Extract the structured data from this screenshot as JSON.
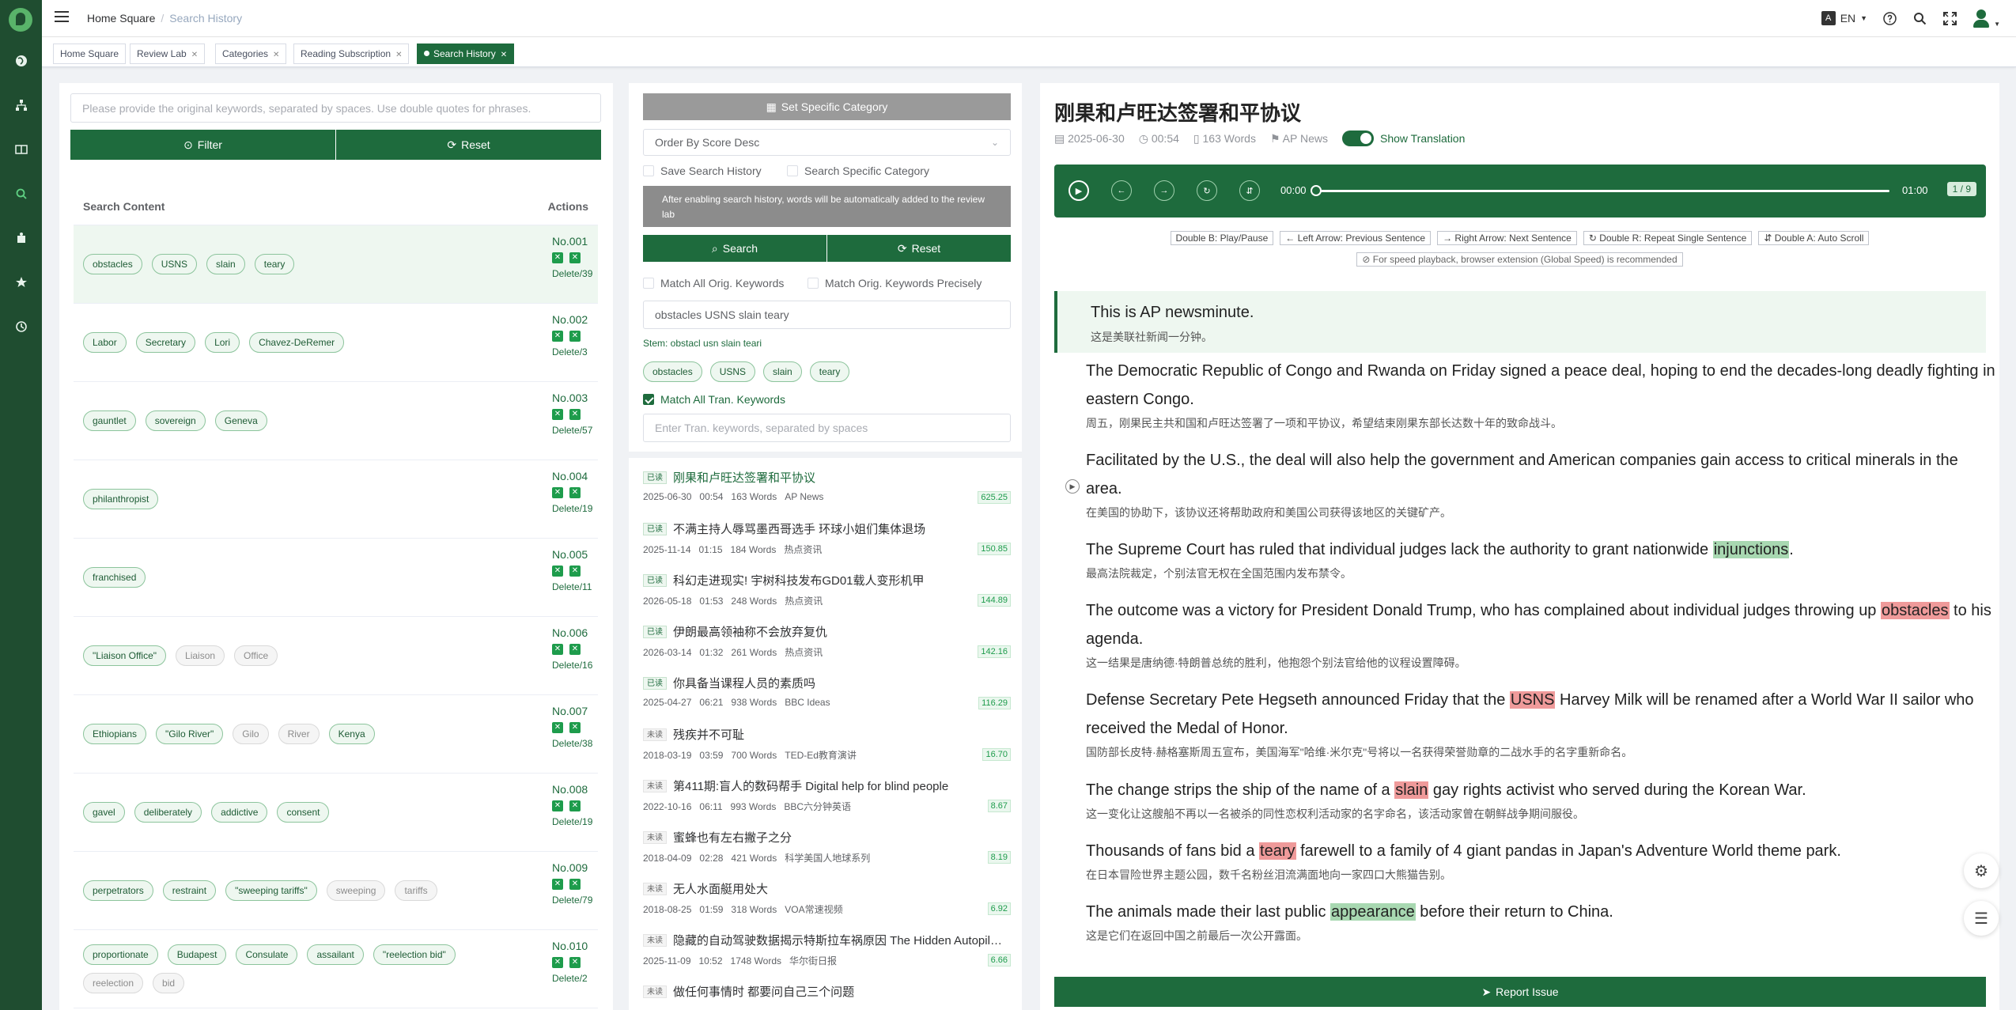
{
  "sidebar": {
    "items": [
      "world-icon",
      "sitemap-icon",
      "book-icon",
      "search-icon",
      "feed-icon",
      "star-icon",
      "history-icon"
    ]
  },
  "header": {
    "breadcrumb": {
      "home": "Home Square",
      "current": "Search History"
    },
    "lang": "EN",
    "lang_icon": "A"
  },
  "tabs": [
    {
      "label": "Home Square"
    },
    {
      "label": "Review Lab"
    },
    {
      "label": "Categories"
    },
    {
      "label": "Reading Subscription"
    },
    {
      "label": "Search History"
    }
  ],
  "history": {
    "placeholder": "Please provide the original keywords, separated by spaces. Use double quotes for phrases.",
    "filter_label": "Filter",
    "reset_label": "Reset",
    "col_content": "Search Content",
    "col_actions": "Actions",
    "rows": [
      {
        "no": "No.001",
        "del": "Delete/39",
        "kw": [
          "obstacles",
          "USNS",
          "slain",
          "teary"
        ],
        "grey": []
      },
      {
        "no": "No.002",
        "del": "Delete/3",
        "kw": [
          "Labor",
          "Secretary",
          "Lori",
          "Chavez-DeRemer"
        ],
        "grey": []
      },
      {
        "no": "No.003",
        "del": "Delete/57",
        "kw": [
          "gauntlet",
          "sovereign",
          "Geneva"
        ],
        "grey": []
      },
      {
        "no": "No.004",
        "del": "Delete/19",
        "kw": [
          "philanthropist"
        ],
        "grey": []
      },
      {
        "no": "No.005",
        "del": "Delete/11",
        "kw": [
          "franchised"
        ],
        "grey": []
      },
      {
        "no": "No.006",
        "del": "Delete/16",
        "kw": [
          "\"Liaison Office\""
        ],
        "grey": [
          "Liaison",
          "Office"
        ]
      },
      {
        "no": "No.007",
        "del": "Delete/38",
        "kw": [
          "Ethiopians",
          "\"Gilo River\""
        ],
        "grey": [
          "Gilo",
          "River"
        ],
        "kw2": [
          "Kenya"
        ]
      },
      {
        "no": "No.008",
        "del": "Delete/19",
        "kw": [
          "gavel",
          "deliberately",
          "addictive",
          "consent"
        ],
        "grey": []
      },
      {
        "no": "No.009",
        "del": "Delete/79",
        "kw": [
          "perpetrators",
          "restraint",
          "\"sweeping tariffs\""
        ],
        "grey": [
          "sweeping",
          "tariffs"
        ]
      },
      {
        "no": "No.010",
        "del": "Delete/2",
        "kw": [
          "proportionate",
          "Budapest",
          "Consulate",
          "assailant",
          "\"reelection bid\""
        ],
        "grey": [
          "reelection",
          "bid"
        ]
      }
    ]
  },
  "search": {
    "set_category": "Set Specific Category",
    "order": "Order By Score Desc",
    "save_history": "Save Search History",
    "search_category": "Search Specific Category",
    "note": "After enabling search history, words will be automatically added to the review lab",
    "search_label": "Search",
    "reset_label": "Reset",
    "match_all": "Match All Orig. Keywords",
    "match_precise": "Match Orig. Keywords Precisely",
    "keywords_value": "obstacles USNS slain teary",
    "stem": "Stem: obstacl usn slain teari",
    "stem_tags": [
      "obstacles",
      "USNS",
      "slain",
      "teary"
    ],
    "match_tran": "Match All Tran. Keywords",
    "tran_placeholder": "Enter Tran. keywords, separated by spaces"
  },
  "articles": [
    {
      "status": "已读",
      "read": true,
      "title": "刚果和卢旺达签署和平协议",
      "date": "2025-06-30",
      "dur": "00:54",
      "words": "163 Words",
      "src": "AP News",
      "score": "625.25"
    },
    {
      "status": "已读",
      "read": false,
      "title": "不满主持人辱骂墨西哥选手 环球小姐们集体退场",
      "date": "2025-11-14",
      "dur": "01:15",
      "words": "184 Words",
      "src": "热点资讯",
      "score": "150.85"
    },
    {
      "status": "已读",
      "read": false,
      "title": "科幻走进现实! 宇树科技发布GD01载人变形机甲",
      "date": "2026-05-18",
      "dur": "01:53",
      "words": "248 Words",
      "src": "热点资讯",
      "score": "144.89"
    },
    {
      "status": "已读",
      "read": false,
      "title": "伊朗最高领袖称不会放弃复仇",
      "date": "2026-03-14",
      "dur": "01:32",
      "words": "261 Words",
      "src": "热点资讯",
      "score": "142.16"
    },
    {
      "status": "已读",
      "read": false,
      "title": "你具备当课程人员的素质吗",
      "date": "2025-04-27",
      "dur": "06:21",
      "words": "938 Words",
      "src": "BBC Ideas",
      "score": "116.29"
    },
    {
      "status": "未读",
      "read": false,
      "title": "残疾并不可耻",
      "date": "2018-03-19",
      "dur": "03:59",
      "words": "700 Words",
      "src": "TED-Ed教育演讲",
      "score": "16.70"
    },
    {
      "status": "未读",
      "read": false,
      "title": "第411期:盲人的数码帮手 Digital help for blind people",
      "date": "2022-10-16",
      "dur": "06:11",
      "words": "993 Words",
      "src": "BBC六分钟英语",
      "score": "8.67"
    },
    {
      "status": "未读",
      "read": false,
      "title": "蜜蜂也有左右撇子之分",
      "date": "2018-04-09",
      "dur": "02:28",
      "words": "421 Words",
      "src": "科学美国人地球系列",
      "score": "8.19"
    },
    {
      "status": "未读",
      "read": false,
      "title": "无人水面艇用处大",
      "date": "2018-08-25",
      "dur": "01:59",
      "words": "318 Words",
      "src": "VOA常速视频",
      "score": "6.92"
    },
    {
      "status": "未读",
      "read": false,
      "title": "隐藏的自动驾驶数据揭示特斯拉车祸原因 The Hidden Autopilot Data",
      "date": "2025-11-09",
      "dur": "10:52",
      "words": "1748 Words",
      "src": "华尔街日报",
      "score": "6.66"
    },
    {
      "status": "未读",
      "read": false,
      "title": "做任何事情时 都要问自己三个问题",
      "date": "",
      "dur": "",
      "words": "",
      "src": "",
      "score": ""
    }
  ],
  "reader": {
    "title": "刚果和卢旺达签署和平协议",
    "date": "2025-06-30",
    "dur": "00:54",
    "words": "163 Words",
    "src": "AP News",
    "show_translation": "Show Translation",
    "time_start": "00:00",
    "time_end": "01:00",
    "page": "1 / 9",
    "hints": [
      "Double B: Play/Pause",
      "Left Arrow: Previous Sentence",
      "Right Arrow: Next Sentence",
      "Double R: Repeat Single Sentence",
      "Double A: Auto Scroll"
    ],
    "speed_hint": "For speed playback, browser extension (Global Speed) is recommended",
    "intro_en": "This is AP newsminute.",
    "intro_zh": "这是美联社新闻一分钟。",
    "s1_en": "The Democratic Republic of Congo and Rwanda on Friday signed a peace deal, hoping to end the decades-long deadly fighting in eastern Congo.",
    "s1_zh": "周五，刚果民主共和国和卢旺达签署了一项和平协议，希望结束刚果东部长达数十年的致命战斗。",
    "s2_en": "Facilitated by the U.S., the deal will also help the government and American companies gain access to critical minerals in the area.",
    "s2_zh": "在美国的协助下，该协议还将帮助政府和美国公司获得该地区的关键矿产。",
    "s3_a": "The Supreme Court has ruled that individual judges lack the authority to grant nationwide ",
    "s3_hl": "injunctions",
    "s3_b": ".",
    "s3_zh": "最高法院裁定，个别法官无权在全国范围内发布禁令。",
    "s4_a": "The outcome was a victory for President Donald Trump, who has complained about individual judges throwing up ",
    "s4_hl": "obstacles",
    "s4_b": " to his agenda.",
    "s4_zh": "这一结果是唐纳德·特朗普总统的胜利，他抱怨个别法官给他的议程设置障碍。",
    "s5_a": "Defense Secretary Pete Hegseth announced Friday that the ",
    "s5_hl": "USNS",
    "s5_b": " Harvey Milk will be renamed after a World War II sailor who received the Medal of Honor.",
    "s5_zh": "国防部长皮特·赫格塞斯周五宣布，美国海军\"哈维·米尔克\"号将以一名获得荣誉勋章的二战水手的名字重新命名。",
    "s6_a": "The change strips the ship of the name of a ",
    "s6_hl": "slain",
    "s6_b": " gay rights activist who served during the Korean War.",
    "s6_zh": "这一变化让这艘船不再以一名被杀的同性恋权利活动家的名字命名，该活动家曾在朝鲜战争期间服役。",
    "s7_a": "Thousands of fans bid a ",
    "s7_hl": "teary",
    "s7_b": " farewell to a family of 4 giant pandas in Japan's Adventure World theme park.",
    "s7_zh": "在日本冒险世界主题公园，数千名粉丝泪流满面地向一家四口大熊猫告别。",
    "s8_a": "The animals made their last public ",
    "s8_hl": "appearance",
    "s8_b": " before their return to China.",
    "s8_zh": "这是它们在返回中国之前最后一次公开露面。",
    "report": "Report Issue"
  },
  "colors": {
    "brand": "#1e6b3d",
    "sidebar": "#1f4d30",
    "highlight_green": "#a8d8b1",
    "highlight_red": "#ef9a9a"
  }
}
